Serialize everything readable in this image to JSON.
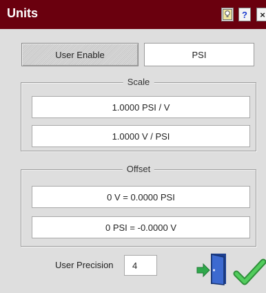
{
  "window": {
    "title": "Units",
    "hint_button_icon": "lightbulb-icon",
    "help_button_label": "?",
    "close_button_label": "×"
  },
  "controls": {
    "user_enable_label": "User Enable",
    "unit_value": "PSI"
  },
  "scale": {
    "legend": "Scale",
    "values": [
      "1.0000 PSI / V",
      "1.0000 V / PSI"
    ]
  },
  "offset": {
    "legend": "Offset",
    "values": [
      "0 V = 0.0000 PSI",
      "0 PSI = -0.0000 V"
    ]
  },
  "precision": {
    "label": "User Precision",
    "value": "4"
  },
  "actions": {
    "exit_icon": "exit-door-icon",
    "ok_icon": "checkmark-icon"
  },
  "colors": {
    "titlebar": "#6a000e",
    "dialog_background": "#dedede",
    "door": "#2e56b8",
    "arrow": "#2fa84b",
    "checkmark": "#39b54a"
  }
}
